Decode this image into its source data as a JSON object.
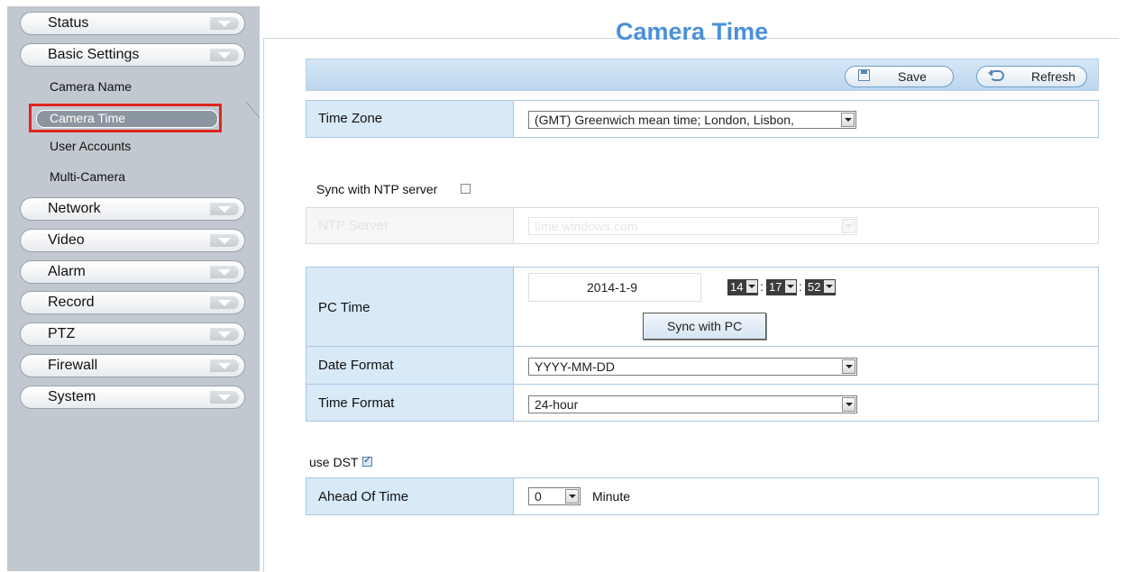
{
  "sidebar": {
    "menu": [
      {
        "label": "Status"
      },
      {
        "label": "Basic Settings"
      },
      {
        "label": "Network"
      },
      {
        "label": "Video"
      },
      {
        "label": "Alarm"
      },
      {
        "label": "Record"
      },
      {
        "label": "PTZ"
      },
      {
        "label": "Firewall"
      },
      {
        "label": "System"
      }
    ],
    "submenu": [
      {
        "label": "Camera Name"
      },
      {
        "label": "Camera Time"
      },
      {
        "label": "User Accounts"
      },
      {
        "label": "Multi-Camera"
      }
    ]
  },
  "page": {
    "title": "Camera Time"
  },
  "toolbar": {
    "save_label": "Save",
    "refresh_label": "Refresh"
  },
  "form": {
    "time_zone": {
      "label": "Time Zone",
      "value": "(GMT) Greenwich mean time; London, Lisbon,"
    },
    "ntp_sync": {
      "label": "Sync with NTP server",
      "checked": false
    },
    "ntp_server": {
      "label": "NTP Server",
      "value": "time.windows.com"
    },
    "pc_time": {
      "label": "PC Time",
      "date": "2014-1-9",
      "hour": "14",
      "minute": "17",
      "second": "52",
      "sync_label": "Sync with PC"
    },
    "date_format": {
      "label": "Date Format",
      "value": "YYYY-MM-DD"
    },
    "time_format": {
      "label": "Time Format",
      "value": "24-hour"
    },
    "use_dst": {
      "label": "use DST",
      "checked": true
    },
    "ahead_of_time": {
      "label": "Ahead Of Time",
      "value": "0",
      "unit": "Minute"
    }
  },
  "colors": {
    "accent": "#4a90d8",
    "sidebar_bg": "#c2c8cf",
    "label_bg": "#d8e9f8",
    "highlight": "#e1241f"
  }
}
